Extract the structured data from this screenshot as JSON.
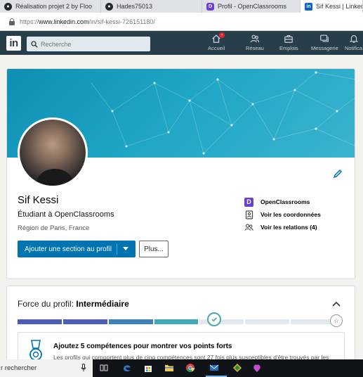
{
  "browser": {
    "tabs": [
      {
        "label": "Réalisation projet 2 by Floo",
        "icon": "github-icon"
      },
      {
        "label": "Hades75013",
        "icon": "github-icon"
      },
      {
        "label": "Profil - OpenClassrooms",
        "icon": "openclassrooms-icon"
      },
      {
        "label": "Sif Kessi | LinkedIn",
        "icon": "linkedin-icon"
      }
    ],
    "url_prefix": "https://",
    "url_host": "www.linkedin.com",
    "url_path": "/in/sif-kessi-726151180/"
  },
  "linkedin_nav": {
    "logo": "in",
    "search_placeholder": "Recherche",
    "items": [
      {
        "label": "Accueil",
        "icon": "home-icon"
      },
      {
        "label": "Réseau",
        "icon": "network-icon"
      },
      {
        "label": "Emplois",
        "icon": "briefcase-icon"
      },
      {
        "label": "Messagerie",
        "icon": "messaging-icon"
      },
      {
        "label": "Notifica",
        "icon": "bell-icon"
      }
    ]
  },
  "profile": {
    "name": "Sif Kessi",
    "headline": "Étudiant à OpenClassrooms",
    "location": "Région de Paris, France",
    "add_section_label": "Ajouter une section au profil",
    "more_label": "Plus...",
    "side_links": [
      {
        "label": "OpenClassrooms",
        "icon": "openclassrooms-icon"
      },
      {
        "label": "Voir les coordonnées",
        "icon": "contact-card-icon"
      },
      {
        "label": "Voir les relations (4)",
        "icon": "people-icon"
      }
    ]
  },
  "strength": {
    "title_prefix": "Force du profil: ",
    "level": "Intermédiaire",
    "progress": 0.62,
    "tip_title": "Ajoutez 5 compétences pour montrer vos points forts",
    "tip_body": "Les profils qui comportent plus de cinq compétences sont 27 fois plus susceptibles d'être trouvés par les"
  },
  "taskbar": {
    "search_text": "r rechercher"
  },
  "colors": {
    "nav_bg": "#283e4a",
    "primary_button": "#0073b1",
    "banner": "#1fa5c4",
    "meter_filled": "#4d5db5",
    "meter_teal": "#3fa9b7"
  }
}
